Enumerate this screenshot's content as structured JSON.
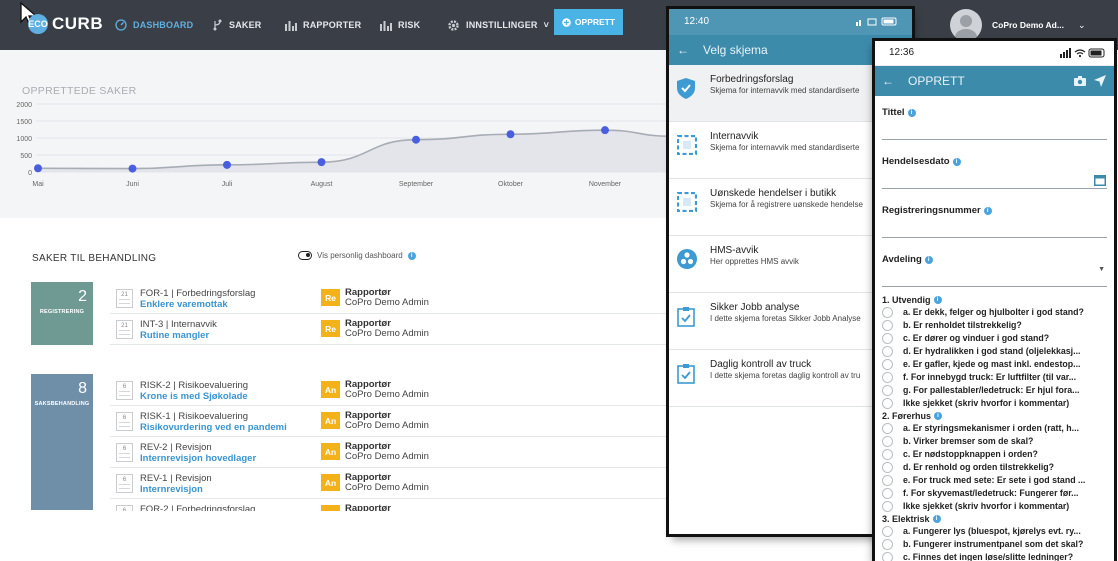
{
  "header": {
    "logo_mark": "ECO",
    "logo_text": "CURB",
    "nav": [
      {
        "label": "DASHBOARD",
        "icon": "dashboard-gauge-icon",
        "active": true
      },
      {
        "label": "SAKER",
        "icon": "branch-icon"
      },
      {
        "label": "RAPPORTER",
        "icon": "bar-chart-icon"
      },
      {
        "label": "RISK",
        "icon": "bar-chart-icon"
      },
      {
        "label": "INNSTILLINGER",
        "icon": "gear-icon",
        "caret": "˅"
      }
    ],
    "create_button": "OPPRETT",
    "user_name": "CoPro Demo Ad...",
    "user_caret": "⌄"
  },
  "chart_data": {
    "type": "area",
    "title": "OPPRETTEDE SAKER",
    "categories": [
      "Mai",
      "Juni",
      "Juli",
      "August",
      "September",
      "Oktober",
      "November"
    ],
    "values": [
      110,
      100,
      210,
      290,
      950,
      1110,
      1230
    ],
    "ylim": [
      0,
      2000
    ],
    "yticks": [
      0,
      500,
      1000,
      1500,
      2000
    ],
    "grid": true,
    "colors": {
      "line": "#a7acb5",
      "fill": "#e3e5ea",
      "point": "#4a5fe0"
    }
  },
  "cases": {
    "title": "SAKER TIL BEHANDLING",
    "toggle_label": "Vis personlig dashboard",
    "info": "i",
    "groups": [
      {
        "count": "2",
        "label": "REGISTRERING",
        "color": "#6f9a94"
      },
      {
        "count": "8",
        "label": "SAKSBEHANDLING",
        "color": "#6f8fa9"
      }
    ],
    "rows": [
      {
        "day": "21",
        "type": "FOR-1 | Forbedringsforslag",
        "name": "Enklere varemottak",
        "badge": "Re",
        "role": "Rapportør",
        "person": "CoPro Demo Admin"
      },
      {
        "day": "21",
        "type": "INT-3 | Internavvik",
        "name": "Rutine mangler",
        "badge": "Re",
        "role": "Rapportør",
        "person": "CoPro Demo Admin"
      },
      {
        "day": "6",
        "type": "RISK-2 | Risikoevaluering",
        "name": "Krone is med Sjøkolade",
        "badge": "An",
        "role": "Rapportør",
        "person": "CoPro Demo Admin"
      },
      {
        "day": "6",
        "type": "RISK-1 | Risikoevaluering",
        "name": "Risikovurdering ved en pandemi",
        "badge": "An",
        "role": "Rapportør",
        "person": "CoPro Demo Admin"
      },
      {
        "day": "6",
        "type": "REV-2 | Revisjon",
        "name": "Internrevisjon hovedlager",
        "badge": "An",
        "role": "Rapportør",
        "person": "CoPro Demo Admin"
      },
      {
        "day": "6",
        "type": "REV-1 | Revisjon",
        "name": "Internrevisjon",
        "badge": "An",
        "role": "Rapportør",
        "person": "CoPro Demo Admin"
      },
      {
        "day": "6",
        "type": "FOR-2 | Forbedringsforslag",
        "name": "",
        "badge": "An",
        "role": "Rapportør",
        "person": ""
      }
    ]
  },
  "phone1": {
    "time": "12:40",
    "title": "Velg skjema",
    "back": "←",
    "forms": [
      {
        "title": "Forbedringsforslag",
        "desc": "Skjema for internavvik med standardiserte",
        "icon": "shield-check-icon"
      },
      {
        "title": "Internavvik",
        "desc": "Skjema for internavvik med standardiserte",
        "icon": "dashed-square-icon"
      },
      {
        "title": "Uønskede hendelser i butikk",
        "desc": "Skjema for å registrere uønskede hendelse",
        "icon": "dashed-square-icon"
      },
      {
        "title": "HMS-avvik",
        "desc": "Her opprettes HMS avvik",
        "icon": "fan-icon"
      },
      {
        "title": "Sikker Jobb analyse",
        "desc": "I dette skjema foretas Sikker Jobb Analyse",
        "icon": "clipboard-check-icon"
      },
      {
        "title": "Daglig kontroll av truck",
        "desc": "I dette skjema foretas daglig kontroll av tru",
        "icon": "clipboard-check-icon"
      }
    ]
  },
  "phone2": {
    "time": "12:36",
    "title": "OPPRETT",
    "back": "←",
    "fields": [
      {
        "label": "Tittel"
      },
      {
        "label": "Hendelsesdato"
      },
      {
        "label": "Registreringsnummer"
      },
      {
        "label": "Avdeling"
      }
    ],
    "sections": [
      {
        "title": "1. Utvendig",
        "items": [
          "a. Er dekk, felger og hjulbolter i god stand?",
          "b. Er renholdet tilstrekkelig?",
          "c. Er dører og vinduer i god stand?",
          "d. Er hydralikken i god stand (oljelekkasj...",
          "e. Er gafler, kjede og mast inkl. endestop...",
          "f. For innebygd truck: Er luftfilter (til var...",
          "g. For pallestabler/ledetruck: Er hjul fora...",
          "Ikke sjekket (skriv hvorfor i kommentar)"
        ]
      },
      {
        "title": "2. Førerhus",
        "items": [
          "a. Er styringsmekanismer i orden (ratt, h...",
          "b. Virker bremser som de skal?",
          "c. Er nødstoppknappen i orden?",
          "d. Er renhold og orden tilstrekkelig?",
          "e. For truck med sete: Er sete i god stand ...",
          "f. For skyvemast/ledetruck: Fungerer før...",
          "Ikke sjekket (skriv hvorfor i kommentar)"
        ]
      },
      {
        "title": "3. Elektrisk",
        "items": [
          "a. Fungerer lys (bluespot, kjørelys evt. ry...",
          "b. Fungerer instrumentpanel som det skal?",
          "c. Finnes det ingen løse/slitte ledninger?"
        ]
      }
    ]
  }
}
